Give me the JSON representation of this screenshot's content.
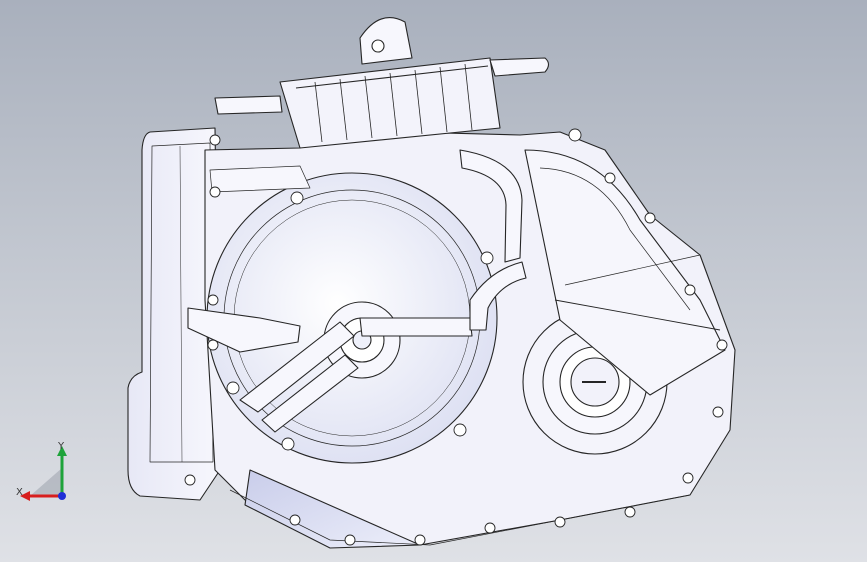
{
  "viewport": {
    "background_top": "#a9b0bd",
    "background_bottom": "#dfe1e6"
  },
  "model": {
    "description_icon": "transmission-assembly-wireframe",
    "fill": "#f4f4fb",
    "shade": "#cfd2ec",
    "stroke": "#262626"
  },
  "triad": {
    "x_label": "X",
    "y_label": "Y",
    "x_color": "#d81e1e",
    "y_color": "#1ea33a",
    "z_color": "#1f2fd6"
  }
}
